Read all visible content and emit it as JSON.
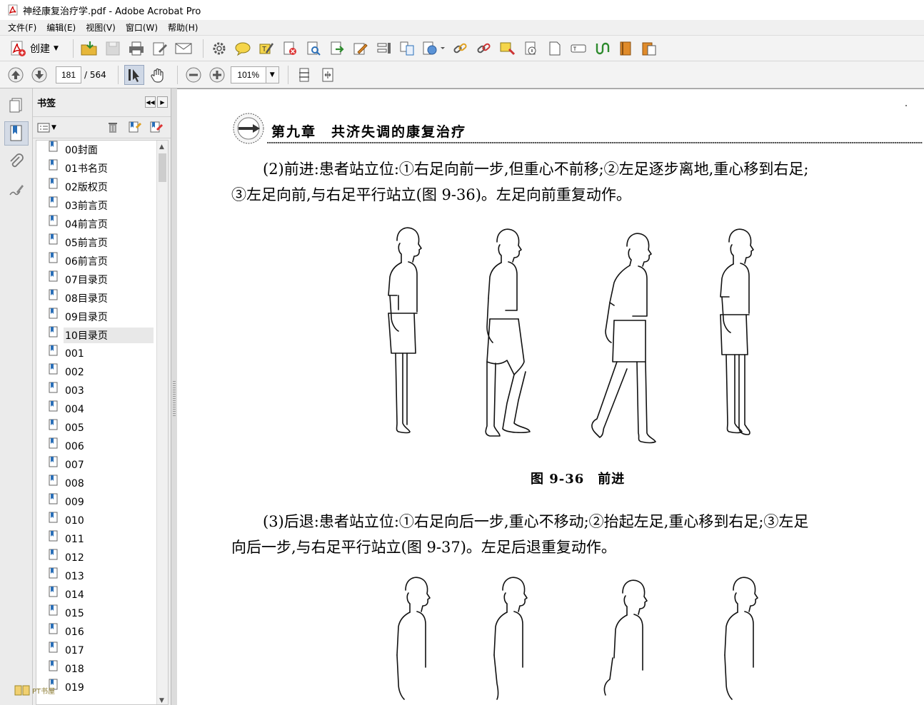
{
  "window": {
    "title": "神经康复治疗学.pdf - Adobe Acrobat Pro"
  },
  "menu": [
    "文件(F)",
    "编辑(E)",
    "视图(V)",
    "窗口(W)",
    "帮助(H)"
  ],
  "toolbar": {
    "create_label": "创建"
  },
  "navigation": {
    "current_page": "181",
    "total_pages": "/ 564",
    "zoom": "101%"
  },
  "bookmarks": {
    "title": "书签",
    "selected_index": 10,
    "items": [
      "00封面",
      "01书名页",
      "02版权页",
      "03前言页",
      "04前言页",
      "05前言页",
      "06前言页",
      "07目录页",
      "08目录页",
      "09目录页",
      "10目录页",
      "001",
      "002",
      "003",
      "004",
      "005",
      "006",
      "007",
      "008",
      "009",
      "010",
      "011",
      "012",
      "013",
      "014",
      "015",
      "016",
      "017",
      "018",
      "019"
    ]
  },
  "watermark": {
    "text": "PT书屋"
  },
  "document": {
    "chapter_title": "第九章　共济失调的康复治疗",
    "para1_line1": "(2)前进:患者站立位:①右足向前一步,但重心不前移;②左足逐步离地,重心移到右足;",
    "para1_line2": "③左足向前,与右足平行站立(图 9-36)。左足向前重复动作。",
    "figure_caption": "图 9-36　前进",
    "para2_line1": "(3)后退:患者站立位:①右足向后一步,重心不移动;②抬起左足,重心移到右足;③左足",
    "para2_line2": "向后一步,与右足平行站立(图 9-37)。左足后退重复动作。"
  }
}
